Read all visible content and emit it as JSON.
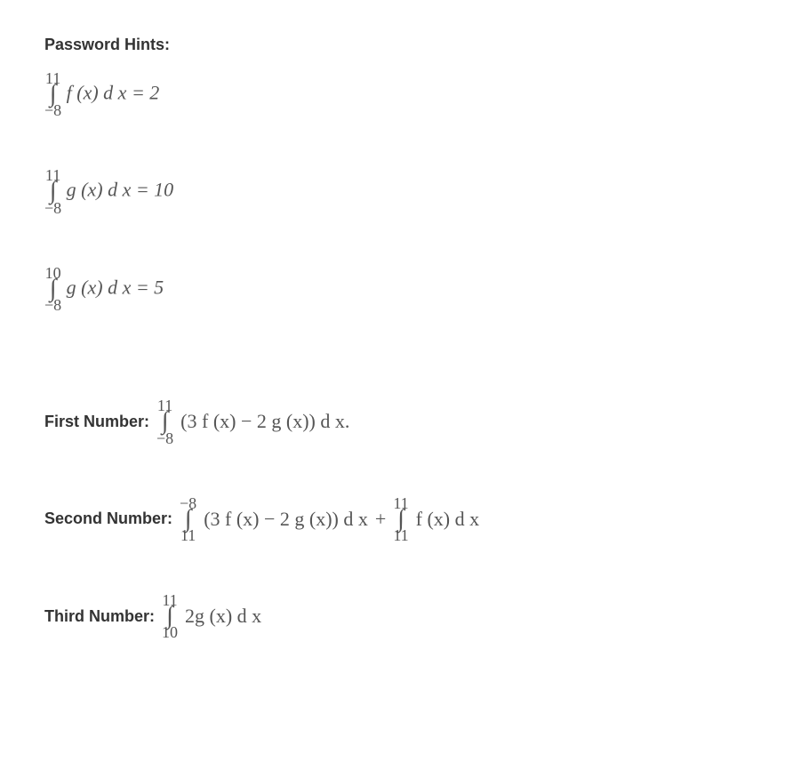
{
  "heading": "Password Hints:",
  "hints": [
    {
      "upper": "11",
      "lower": "−8",
      "body": "f (x) d x = 2"
    },
    {
      "upper": "11",
      "lower": "−8",
      "body": "g (x) d x = 10"
    },
    {
      "upper": "10",
      "lower": "−8",
      "body": "g (x) d x = 5"
    }
  ],
  "numbers": {
    "first": {
      "label": "First Number:",
      "int1_upper": "11",
      "int1_lower": "−8",
      "body": "(3 f (x) − 2 g (x)) d x.",
      "plus": "",
      "int2_upper": "",
      "int2_lower": "",
      "body2": ""
    },
    "second": {
      "label": "Second Number:",
      "int1_upper": "−8",
      "int1_lower": "11",
      "body": "(3 f (x) − 2 g (x)) d x",
      "plus": "+",
      "int2_upper": "11",
      "int2_lower": "11",
      "body2": "f (x) d x"
    },
    "third": {
      "label": "Third Number:",
      "int1_upper": "11",
      "int1_lower": "10",
      "body": "2g (x) d x",
      "plus": "",
      "int2_upper": "",
      "int2_lower": "",
      "body2": ""
    }
  },
  "integral_sign": "∫"
}
